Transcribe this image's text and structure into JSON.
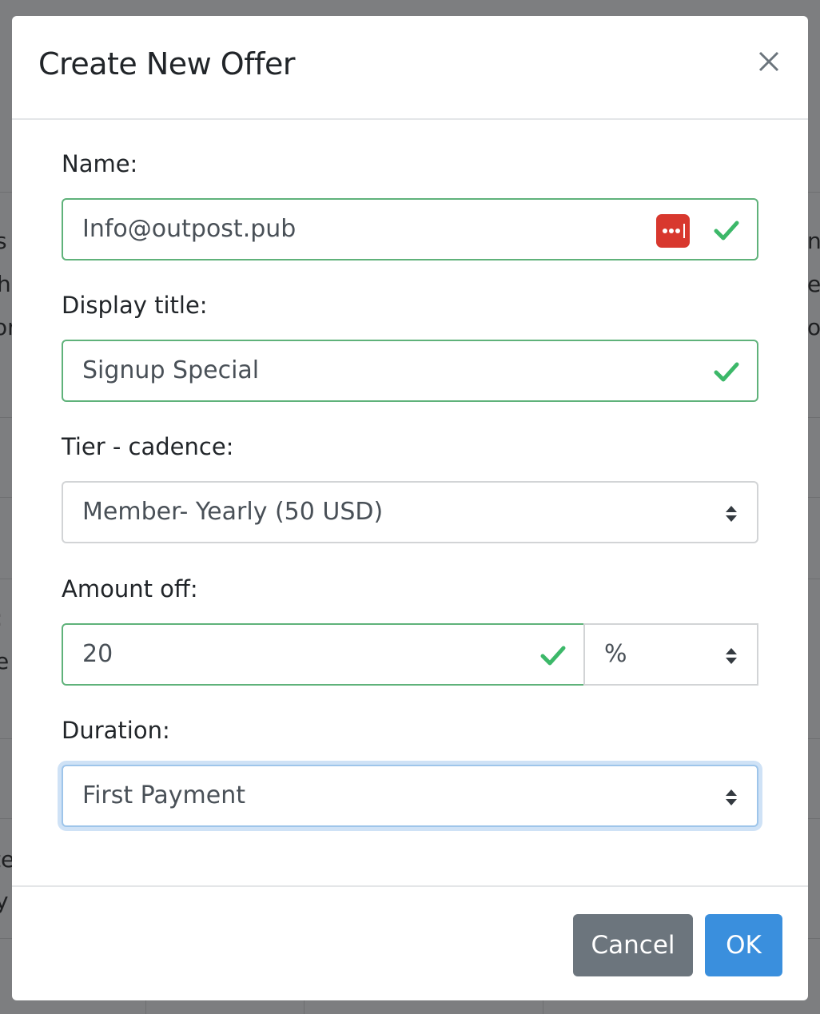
{
  "modal": {
    "title": "Create New Offer",
    "close_icon": "close-icon"
  },
  "form": {
    "name": {
      "label": "Name:",
      "value": "Info@outpost.pub",
      "valid": true,
      "extension_icon": "password-manager-icon"
    },
    "display_title": {
      "label": "Display title:",
      "value": "Signup Special",
      "valid": true
    },
    "tier_cadence": {
      "label": "Tier - cadence:",
      "selected": "Member- Yearly (50 USD)"
    },
    "amount_off": {
      "label": "Amount off:",
      "value": "20",
      "valid": true,
      "unit_selected": "%"
    },
    "duration": {
      "label": "Duration:",
      "selected": "First Payment",
      "focused": true
    }
  },
  "footer": {
    "cancel_label": "Cancel",
    "ok_label": "OK"
  },
  "colors": {
    "valid_border": "#5fb27a",
    "check": "#3cb869",
    "primary": "#3a8fdd",
    "secondary": "#6c757d",
    "password_manager": "#d8382e"
  },
  "background_fragments": {
    "left": [
      "s",
      "h",
      "or",
      "",
      ":",
      "e",
      "te",
      "y"
    ],
    "right": [
      "n",
      "e",
      "o"
    ]
  }
}
